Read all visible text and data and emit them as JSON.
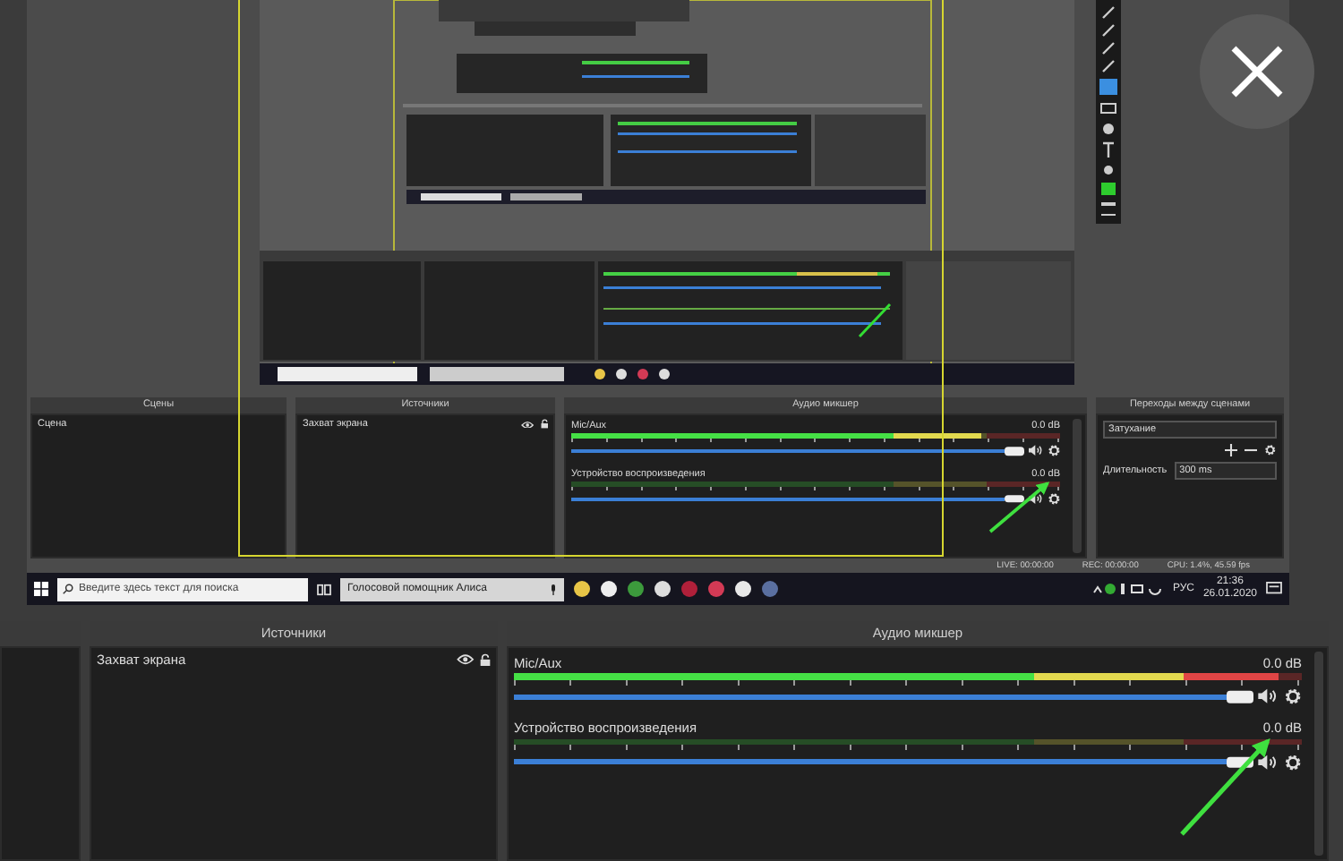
{
  "capture": {
    "scenes": {
      "title": "Сцены",
      "items": [
        "Сцена"
      ]
    },
    "sources": {
      "title": "Источники",
      "items": [
        {
          "label": "Захват экрана",
          "visible": true
        }
      ]
    },
    "mixer": {
      "title": "Аудио микшер",
      "channels": [
        {
          "name": "Mic/Aux",
          "reading": "0.0 dB",
          "level": 0.84,
          "volume": {
            "level": 1
          }
        },
        {
          "name": "Устройство воспроизведения",
          "reading": "0.0 dB",
          "level": 0,
          "volume": {
            "level": 1
          }
        }
      ]
    },
    "transitions": {
      "title": "Переходы между сценами",
      "transition": "Затухание",
      "duration_label": "Длительность",
      "duration": "300 ms"
    },
    "status": [
      "LIVE: 00:00:00",
      "REC: 00:00:00",
      "CPU: 1.4%, 45.59 fps"
    ],
    "taskbar": {
      "search": {
        "placeholder": "Введите здесь текст для поиска"
      },
      "assistant": "Голосовой помощник Алиса",
      "language": "РУС",
      "time": "21:36",
      "date": "26.01.2020"
    }
  },
  "main": {
    "sources": {
      "title": "Источники",
      "items": [
        {
          "label": "Захват экрана",
          "visible": true
        }
      ]
    },
    "mixer": {
      "title": "Аудио микшер",
      "channels": [
        {
          "name": "Mic/Aux",
          "reading": "0.0 dB",
          "level": 0.97,
          "volume": {
            "level": 1
          }
        },
        {
          "name": "Устройство воспроизведения",
          "reading": "0.0 dB",
          "level": 0,
          "volume": {
            "level": 1
          }
        }
      ]
    }
  }
}
